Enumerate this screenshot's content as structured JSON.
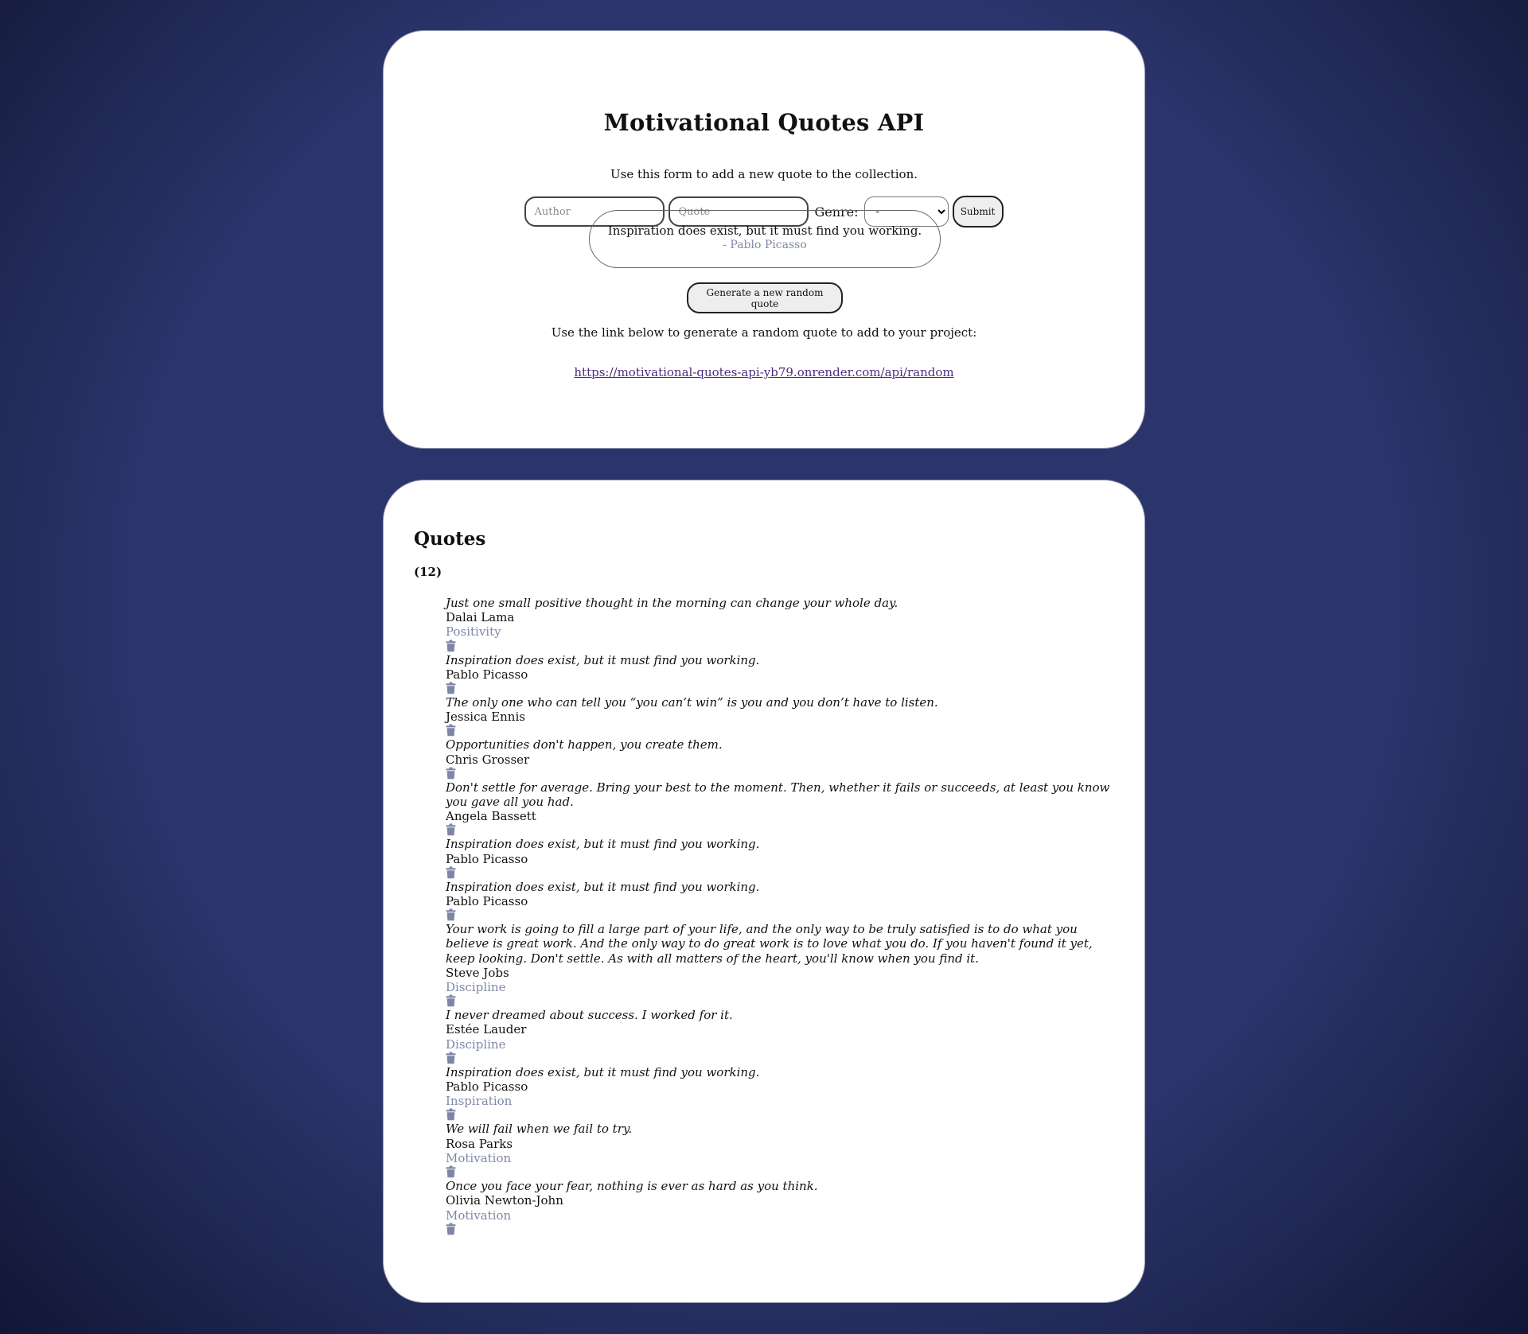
{
  "header": {
    "title": "Motivational Quotes API",
    "intro": "Use this form to add a new quote to the collection."
  },
  "form": {
    "author_placeholder": "Author",
    "quote_placeholder": "Quote",
    "genre_label": "Genre:",
    "genre_selected": "-",
    "submit_label": "Submit"
  },
  "random_quote": {
    "text": "Inspiration does exist, but it must find you working.",
    "author": "- Pablo Picasso",
    "button_label": "Generate a new random quote"
  },
  "api": {
    "intro": "Use the link below to generate a random quote to add to your project:",
    "link": "https://motivational-quotes-api-yb79.onrender.com/api/random"
  },
  "quotes": {
    "heading": "Quotes",
    "count": "(12)",
    "delete_icon": "trash-icon",
    "items": [
      {
        "text": "Just one small positive thought in the morning can change your whole day.",
        "author": "Dalai Lama",
        "genre": "Positivity"
      },
      {
        "text": "Inspiration does exist, but it must find you working.",
        "author": "Pablo Picasso",
        "genre": ""
      },
      {
        "text": "The only one who can tell you “you can’t win” is you and you don’t have to listen.",
        "author": "Jessica Ennis",
        "genre": ""
      },
      {
        "text": "Opportunities don't happen, you create them.",
        "author": "Chris Grosser",
        "genre": ""
      },
      {
        "text": "Don't settle for average. Bring your best to the moment. Then, whether it fails or succeeds, at least you know you gave all you had.",
        "author": "Angela Bassett",
        "genre": ""
      },
      {
        "text": "Inspiration does exist, but it must find you working.",
        "author": "Pablo Picasso",
        "genre": ""
      },
      {
        "text": "Inspiration does exist, but it must find you working.",
        "author": "Pablo Picasso",
        "genre": ""
      },
      {
        "text": "Your work is going to fill a large part of your life, and the only way to be truly satisfied is to do what you believe is great work. And the only way to do great work is to love what you do. If you haven't found it yet, keep looking. Don't settle. As with all matters of the heart, you'll know when you find it.",
        "author": "Steve Jobs",
        "genre": "Discipline"
      },
      {
        "text": "I never dreamed about success. I worked for it.",
        "author": "Estée Lauder",
        "genre": "Discipline"
      },
      {
        "text": "Inspiration does exist, but it must find you working.",
        "author": "Pablo Picasso",
        "genre": "Inspiration"
      },
      {
        "text": "We will fail when we fail to try.",
        "author": "Rosa Parks",
        "genre": "Motivation"
      },
      {
        "text": "Once you face your fear, nothing is ever as hard as you think.",
        "author": "Olivia Newton-John",
        "genre": "Motivation"
      }
    ]
  },
  "colors": {
    "background": "#2b346b",
    "genre_text": "#8088a8",
    "link": "#4b2d7f",
    "icon": "#7f86a5"
  }
}
